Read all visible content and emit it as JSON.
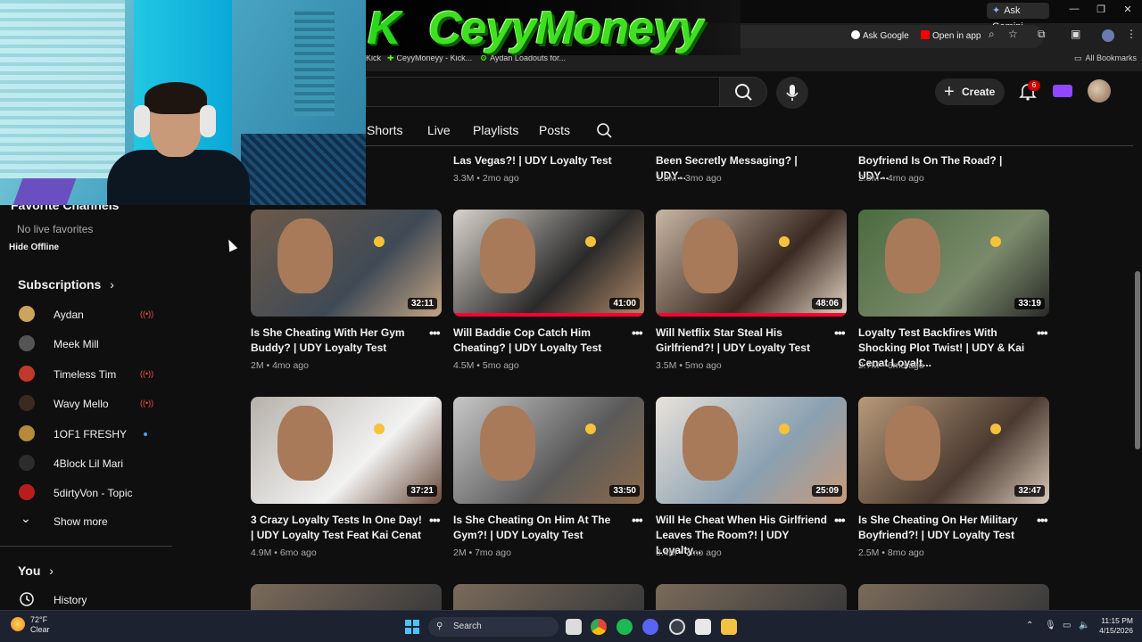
{
  "browser": {
    "gemini_label": "Ask Gemini",
    "omnibox_chips": {
      "ask_google": "Ask Google",
      "open_in_app": "Open in app"
    },
    "bookmarks": [
      "Kick",
      "CeyyMoneyy - Kick...",
      "Aydan Loadouts for...",
      "All Bookmarks"
    ]
  },
  "kick_banner": {
    "logo": "K",
    "name": "CeyyMoneyy"
  },
  "header": {
    "create_label": "Create",
    "notification_count": "6"
  },
  "channel_tabs": [
    "Shorts",
    "Live",
    "Playlists",
    "Posts"
  ],
  "sidebar": {
    "favorite_channels": "Favorite Channels",
    "no_live_favorites": "No live favorites",
    "hide_offline": "Hide Offline",
    "subscriptions_heading": "Subscriptions",
    "subscriptions": [
      {
        "name": "Aydan",
        "live": true,
        "new": false,
        "color": "#caa55a"
      },
      {
        "name": "Meek Mill",
        "live": false,
        "new": false,
        "color": "#555555"
      },
      {
        "name": "Timeless Tim",
        "live": true,
        "new": false,
        "color": "#c0392b"
      },
      {
        "name": "Wavy Mello",
        "live": true,
        "new": false,
        "color": "#3b2a20"
      },
      {
        "name": "1OF1 FRESHY",
        "live": false,
        "new": true,
        "color": "#b58a3a"
      },
      {
        "name": "4Block Lil Mari",
        "live": false,
        "new": false,
        "color": "#2c2c2c"
      },
      {
        "name": "5dirtyVon - Topic",
        "live": false,
        "new": false,
        "color": "#b81d1d"
      }
    ],
    "live_glyph": "((•))",
    "show_more": "Show more",
    "you_heading": "You",
    "history": "History"
  },
  "top_row_partial": [
    {
      "title": "Las Vegas?! | UDY Loyalty Test",
      "meta": "3.3M • 2mo ago"
    },
    {
      "title": "Been Secretly Messaging? | UDY...",
      "meta": "1.8M • 3mo ago"
    },
    {
      "title": "Boyfriend Is On The Road? | UDY...",
      "meta": "2.8M • 4mo ago"
    }
  ],
  "partial_left_text": "t",
  "videos_row1": [
    {
      "title": "Is She Cheating With Her Gym Buddy? | UDY Loyalty Test",
      "meta": "2M • 4mo ago",
      "duration": "32:11",
      "progress": 0
    },
    {
      "title": "Will Baddie Cop Catch Him Cheating? | UDY Loyalty Test",
      "meta": "4.5M • 5mo ago",
      "duration": "41:00",
      "progress": 1.0
    },
    {
      "title": "Will Netflix Star Steal His Girlfriend?! | UDY Loyalty Test",
      "meta": "3.5M • 5mo ago",
      "duration": "48:06",
      "progress": 1.0
    },
    {
      "title": "Loyalty Test Backfires With Shocking Plot Twist! | UDY & Kai Cenat Loyalt...",
      "meta": "2.7M • 6mo ago",
      "duration": "33:19",
      "progress": 0
    }
  ],
  "videos_row2": [
    {
      "title": "3 Crazy Loyalty Tests In One Day! | UDY Loyalty Test Feat Kai Cenat",
      "meta": "4.9M • 6mo ago",
      "duration": "37:21",
      "progress": 0
    },
    {
      "title": "Is She Cheating On Him At The Gym?! | UDY Loyalty Test",
      "meta": "2M • 7mo ago",
      "duration": "33:50",
      "progress": 0
    },
    {
      "title": "Will He Cheat When His Girlfriend Leaves The Room?! | UDY Loyalty...",
      "meta": "3.4M • 7mo ago",
      "duration": "25:09",
      "progress": 0
    },
    {
      "title": "Is She Cheating On Her Military Boyfriend?! | UDY Loyalty Test",
      "meta": "2.5M • 8mo ago",
      "duration": "32:47",
      "progress": 0
    }
  ],
  "menu_glyph": "•••",
  "taskbar": {
    "temp": "72°F",
    "weather": "Clear",
    "search_label": "Search",
    "time": "11:15 PM",
    "date": "4/15/2026"
  }
}
